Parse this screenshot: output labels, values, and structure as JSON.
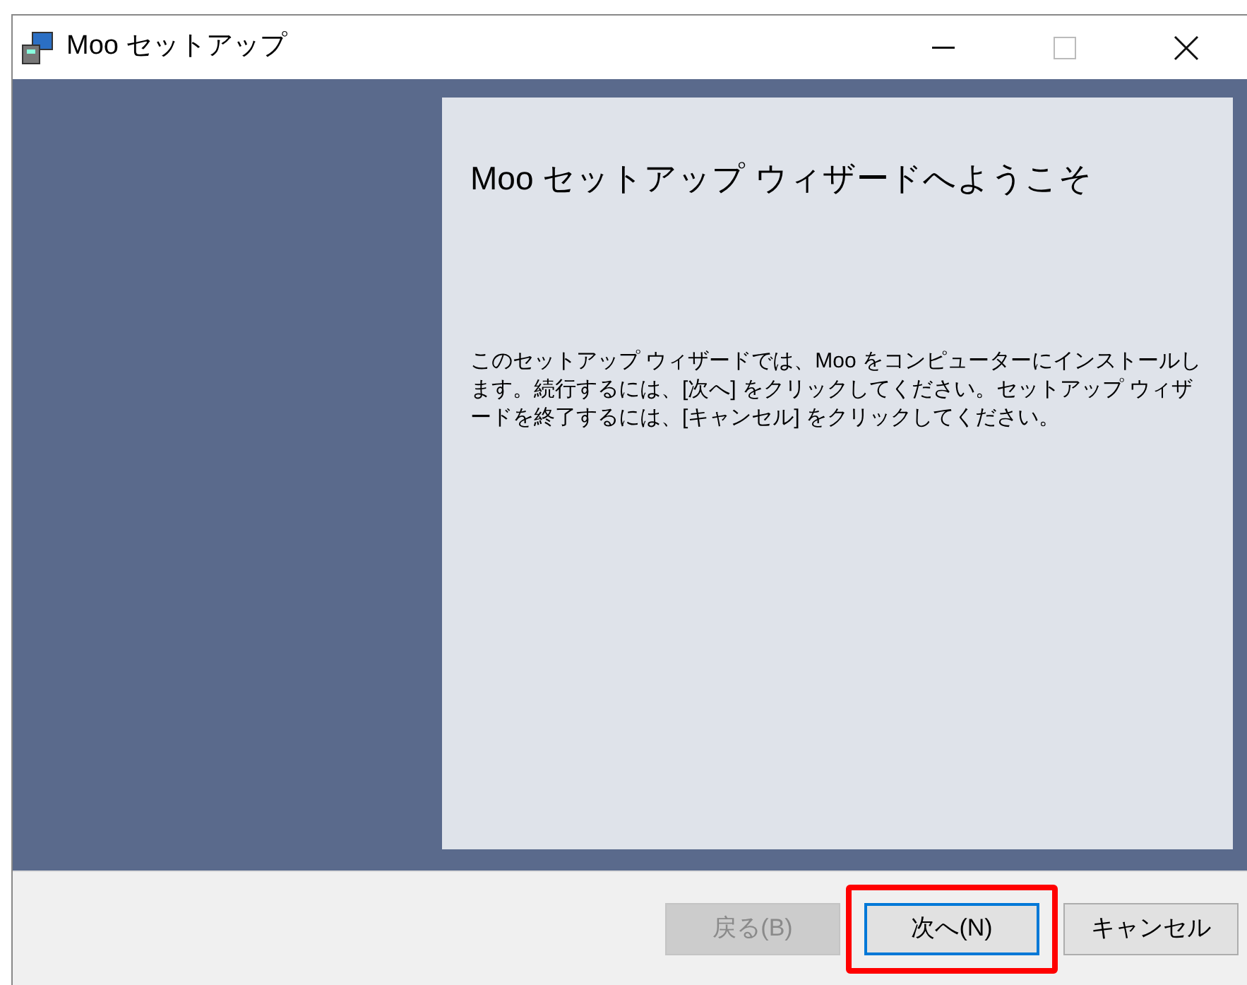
{
  "window": {
    "title": "Moo セットアップ"
  },
  "panel": {
    "heading": "Moo セットアップ ウィザードへようこそ",
    "body": "このセットアップ ウィザードでは、Moo をコンピューターにインストールします。続行するには、[次へ] をクリックしてください。セットアップ ウィザードを終了するには、[キャンセル] をクリックしてください。"
  },
  "buttons": [
    {
      "label": "戻る(B)",
      "disabled": true,
      "focused": false,
      "highlighted": false
    },
    {
      "label": "次へ(N)",
      "disabled": false,
      "focused": true,
      "highlighted": true
    },
    {
      "label": "キャンセル",
      "disabled": false,
      "focused": false,
      "highlighted": false
    }
  ]
}
